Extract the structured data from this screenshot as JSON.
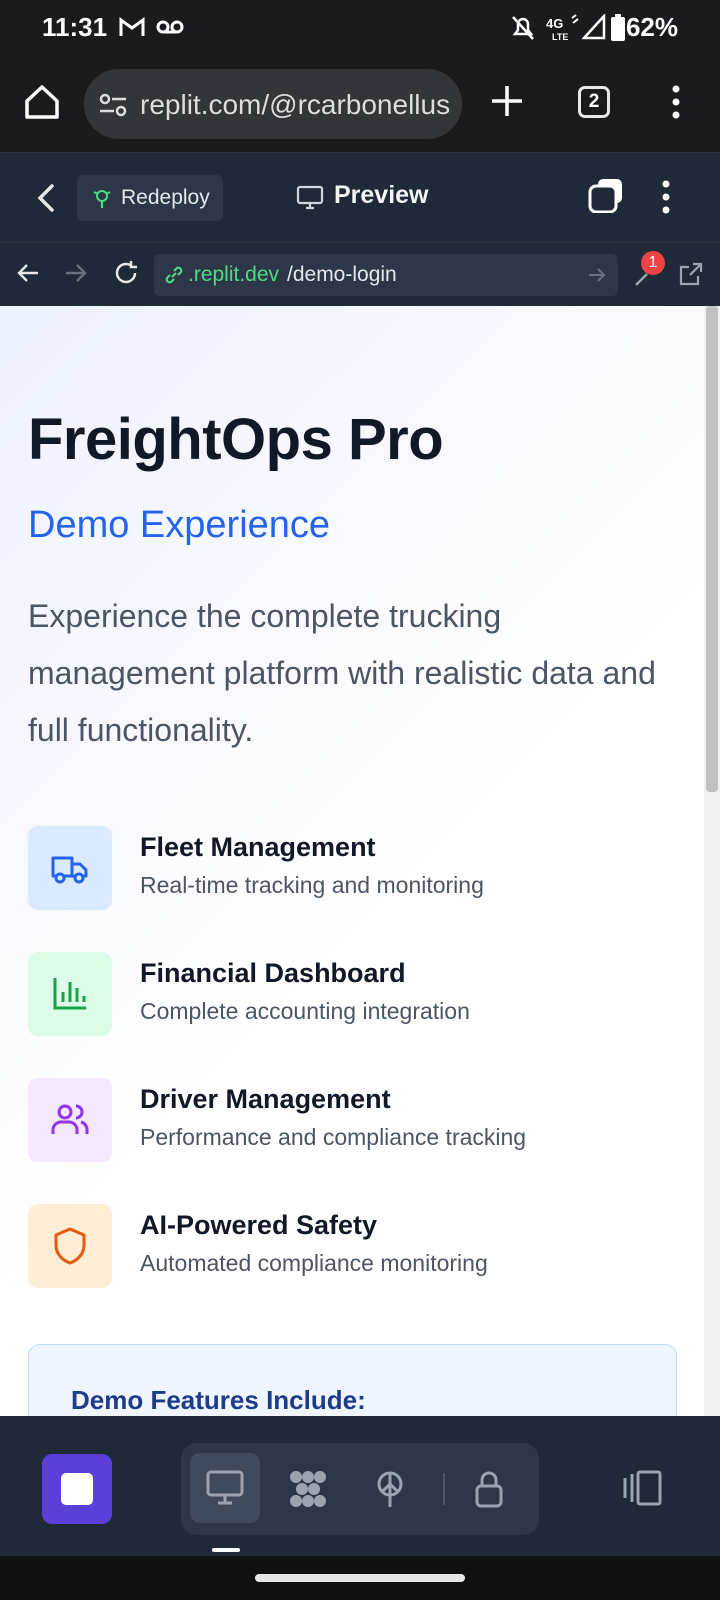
{
  "status_bar": {
    "time": "11:31",
    "battery": "62%",
    "network": "4G LTE"
  },
  "browser": {
    "url": "replit.com/@rcarbonellus",
    "tab_count": "2"
  },
  "replit_header": {
    "redeploy_label": "Redeploy",
    "preview_label": "Preview"
  },
  "webview": {
    "domain": ".replit.dev",
    "path": "/demo-login",
    "badge_count": "1"
  },
  "page": {
    "title": "FreightOps Pro",
    "subtitle": "Demo Experience",
    "description": "Experience the complete trucking management platform with realistic data and full functionality.",
    "features": [
      {
        "title": "Fleet Management",
        "desc": "Real-time tracking and monitoring",
        "icon": "truck-icon",
        "color": "#2563eb",
        "bg": "#dbeafe"
      },
      {
        "title": "Financial Dashboard",
        "desc": "Complete accounting integration",
        "icon": "bar-chart-icon",
        "color": "#16a34a",
        "bg": "#dcfce7"
      },
      {
        "title": "Driver Management",
        "desc": "Performance and compliance tracking",
        "icon": "users-icon",
        "color": "#9333ea",
        "bg": "#f3e8ff"
      },
      {
        "title": "AI-Powered Safety",
        "desc": "Automated compliance monitoring",
        "icon": "shield-icon",
        "color": "#ea580c",
        "bg": "#ffedd5"
      }
    ],
    "demo_card_title": "Demo Features Include:"
  },
  "colors": {
    "accent": "#2563eb",
    "stop_button": "#5b3fd6",
    "replit_bar": "#1f2937"
  }
}
